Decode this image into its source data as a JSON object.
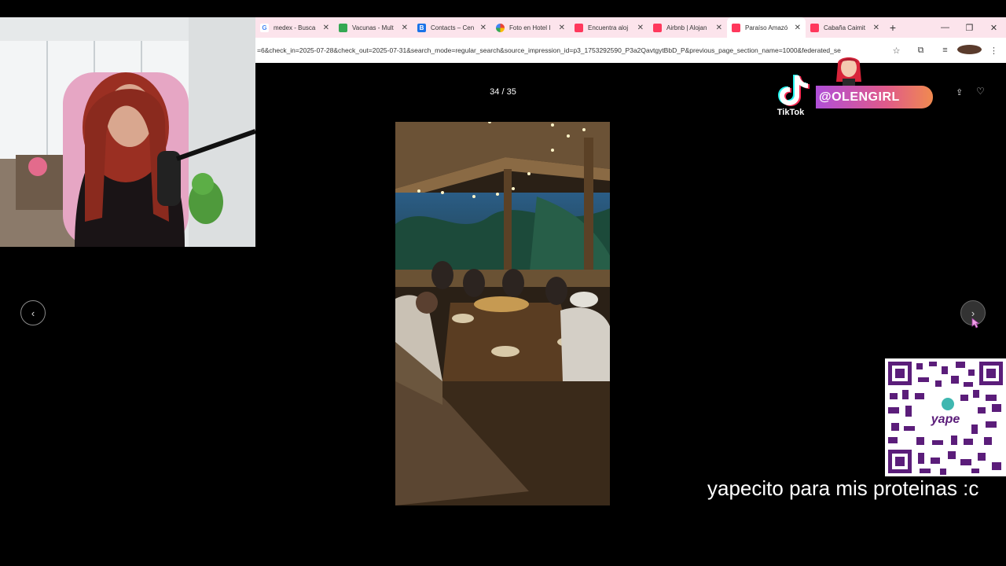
{
  "browser": {
    "tabs": [
      {
        "label": "medex - Busca",
        "favicon_color": "#ffffff",
        "favicon_glyph": "G",
        "favicon_text_color": "#4285f4",
        "active": false
      },
      {
        "label": "Vacunas - Mult",
        "favicon_color": "#34a853",
        "favicon_glyph": "",
        "favicon_text_color": "#ffffff",
        "active": false
      },
      {
        "label": "Contacts – Cen",
        "favicon_color": "#1a73e8",
        "favicon_glyph": "B",
        "favicon_text_color": "#ffffff",
        "active": false
      },
      {
        "label": "Foto en Hotel I",
        "favicon_color": "#fbbc04",
        "favicon_glyph": "",
        "favicon_text_color": "#ffffff",
        "active": false
      },
      {
        "label": "Encuentra aloj",
        "favicon_color": "#ff385c",
        "favicon_glyph": "",
        "favicon_text_color": "#ffffff",
        "active": false
      },
      {
        "label": "Airbnb | Alojan",
        "favicon_color": "#ff385c",
        "favicon_glyph": "",
        "favicon_text_color": "#ffffff",
        "active": false
      },
      {
        "label": "Paraíso Amazó",
        "favicon_color": "#ff385c",
        "favicon_glyph": "",
        "favicon_text_color": "#ffffff",
        "active": true
      },
      {
        "label": "Cabaña Caimit",
        "favicon_color": "#ff385c",
        "favicon_glyph": "",
        "favicon_text_color": "#ffffff",
        "active": false
      }
    ],
    "new_tab_glyph": "+",
    "window_controls": {
      "minimize": "—",
      "restore": "❐",
      "close": "✕"
    },
    "url": "=6&check_in=2025-07-28&check_out=2025-07-31&search_mode=regular_search&source_impression_id=p3_1753292590_P3a2QavtgytBbD_P&previous_page_section_name=1000&federated_se"
  },
  "gallery": {
    "counter": "34 / 35",
    "prev_glyph": "‹",
    "next_glyph": "›"
  },
  "overlay": {
    "tiktok_label": "TikTok",
    "handle": "@OLENGIRL",
    "qr_brand": "yape",
    "caption": "yapecito para mis proteinas :c"
  }
}
